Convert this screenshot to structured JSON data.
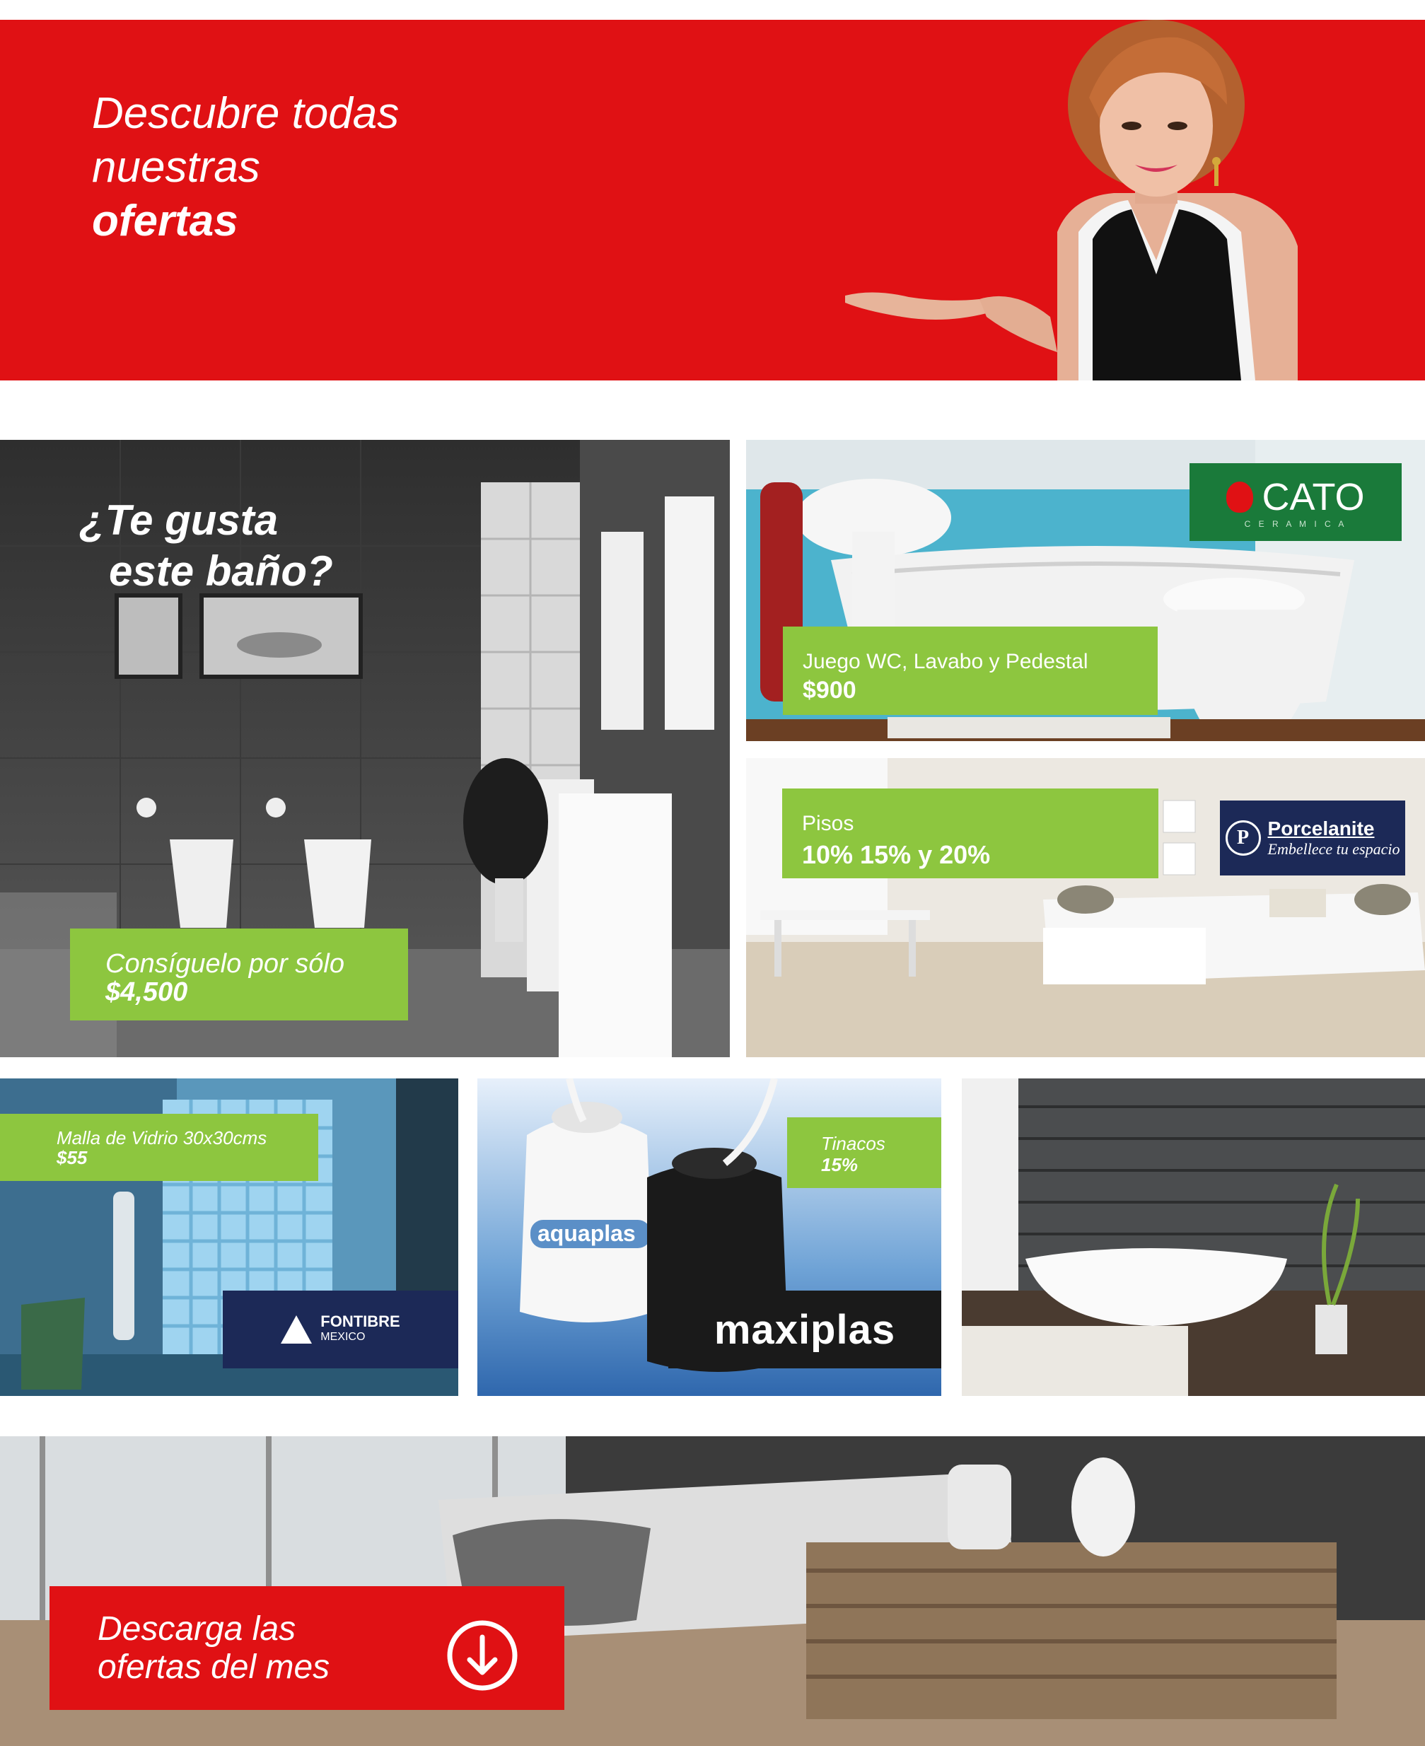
{
  "colors": {
    "brand_red": "#e01114",
    "tag_green": "#8dc63f",
    "navy": "#1c2957",
    "cato_green": "#1a7a3a"
  },
  "hero": {
    "line1": "Descubre todas",
    "line2": "nuestras",
    "line3": "ofertas"
  },
  "bathroom_promo": {
    "question_line1": "¿Te gusta",
    "question_line2": "este baño?",
    "offer_line1": "Consíguelo por sólo",
    "offer_price": "$4,500"
  },
  "cato_promo": {
    "brand": "CATO",
    "brand_sub": "C E R A M I C A",
    "product": "Juego WC, Lavabo y Pedestal",
    "price": "$900"
  },
  "porcelanite_promo": {
    "brand": "Porcelanite",
    "tagline": "Embellece tu espacio",
    "product": "Pisos",
    "discount": "10% 15% y 20%"
  },
  "fontibre_promo": {
    "product": "Malla de Vidrio 30x30cms",
    "price": "$55",
    "brand": "FONTIBRE",
    "brand_sub": "MEXICO"
  },
  "tinacos_promo": {
    "product": "Tinacos",
    "discount": "15%",
    "brand": "maxiplas",
    "tank_label": "aquaplas"
  },
  "download": {
    "line1": "Descarga las",
    "line2": "ofertas del mes",
    "icon": "download-arrow-icon"
  }
}
